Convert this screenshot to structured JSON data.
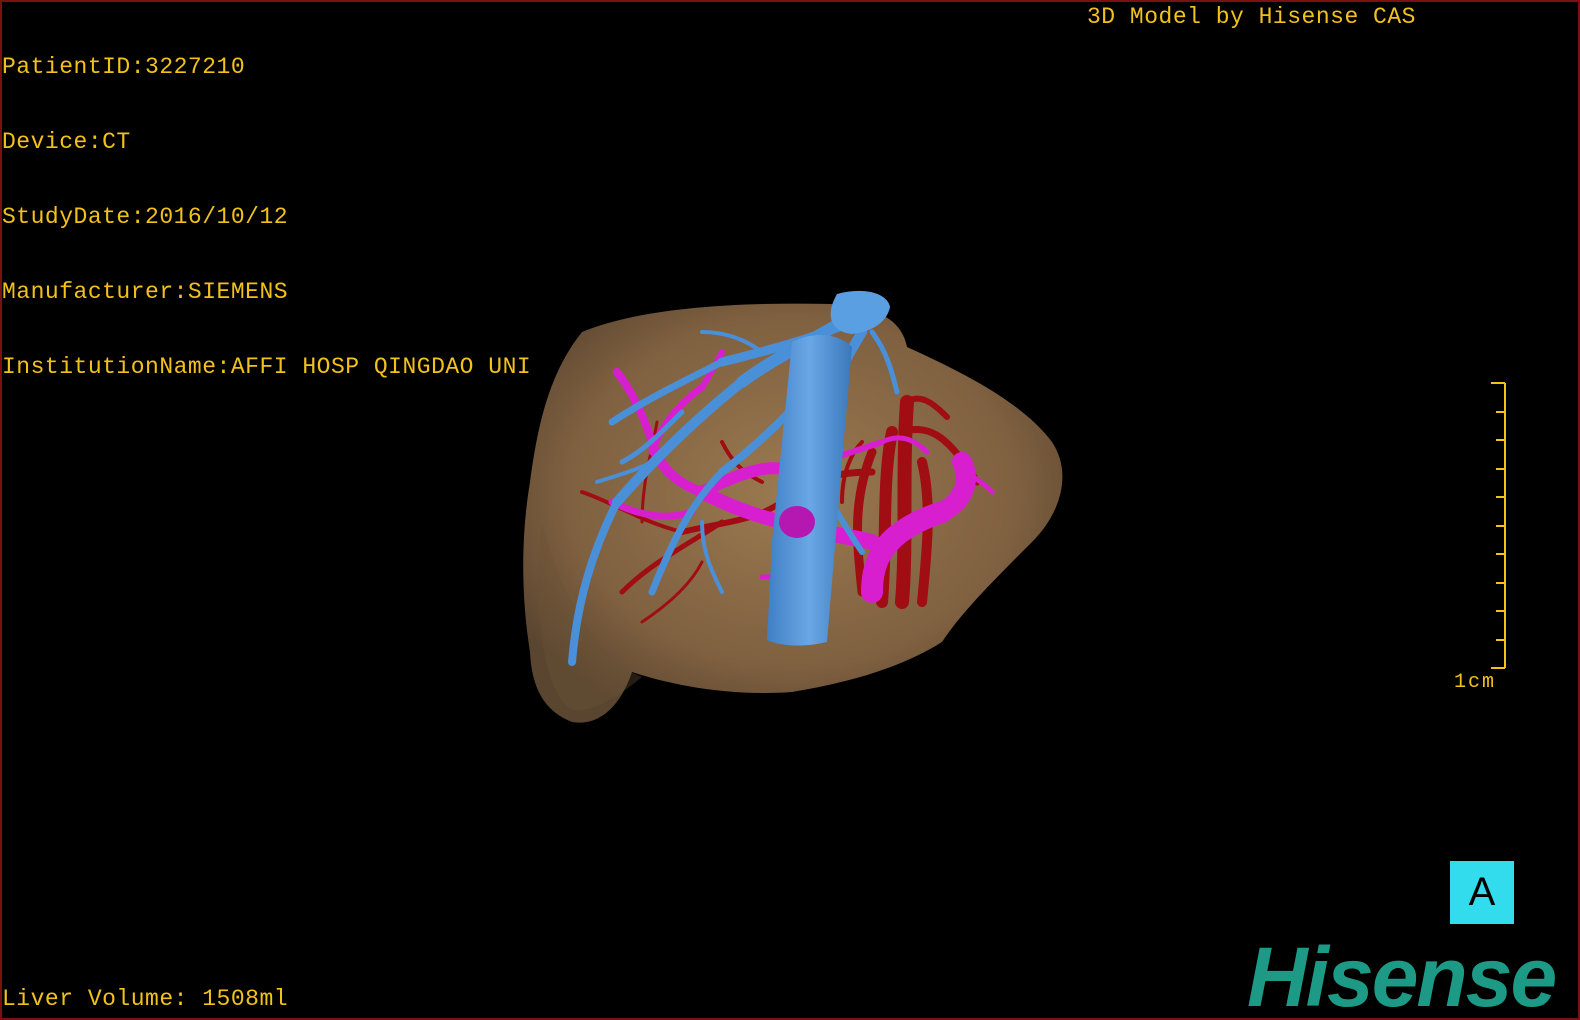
{
  "patient_info": {
    "patient_id": "PatientID:3227210",
    "device": "Device:CT",
    "study_date": "StudyDate:2016/10/12",
    "manufacturer": "Manufacturer:SIEMENS",
    "institution": "InstitutionName:AFFI HOSP QINGDAO UNI"
  },
  "model_credit": "3D Model by Hisense CAS",
  "liver_volume": "Liver Volume: 1508ml",
  "scale_bar": {
    "label": "1cm",
    "color": "#f2c21a"
  },
  "orientation_marker": {
    "label": "A",
    "color": "#33dcec"
  },
  "brand": {
    "logo_text": "Hisense",
    "color": "#1d9a86"
  },
  "model_colors": {
    "liver": "#8a6b45",
    "hepatic_vein": "#4a90d9",
    "portal_vein": "#d81fd0",
    "artery": "#a00d12"
  },
  "text_color": "#f2c21a",
  "frame_color": "#7a1010"
}
